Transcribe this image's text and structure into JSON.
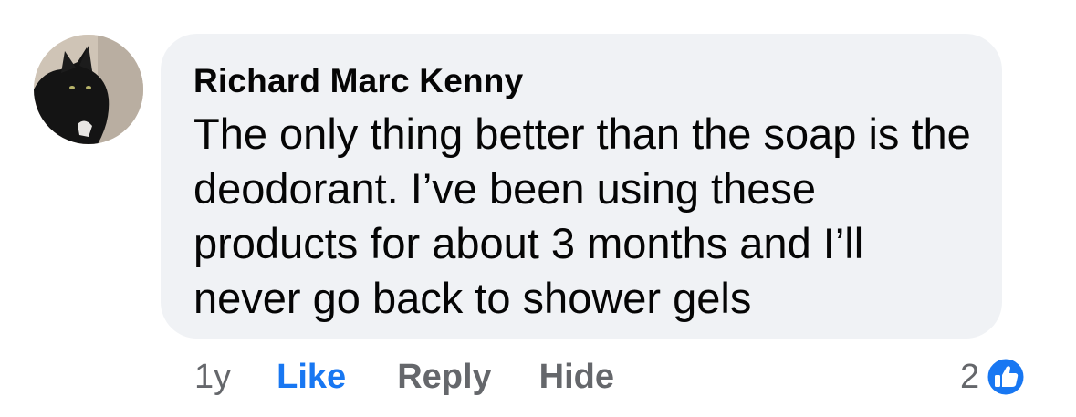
{
  "comment": {
    "author": "Richard Marc Kenny",
    "text": "The only thing better than the soap is the deodorant. I’ve been using these products for about 3 months and I’ll never go back to shower gels",
    "timestamp": "1y",
    "actions": {
      "like": "Like",
      "reply": "Reply",
      "hide": "Hide"
    },
    "reactions": {
      "count": "2",
      "icon": "thumbs-up-icon"
    },
    "avatar_icon": "black-cat-avatar"
  },
  "colors": {
    "bubble_bg": "#f0f2f5",
    "text": "#050505",
    "muted": "#65676b",
    "accent": "#1877f2"
  }
}
